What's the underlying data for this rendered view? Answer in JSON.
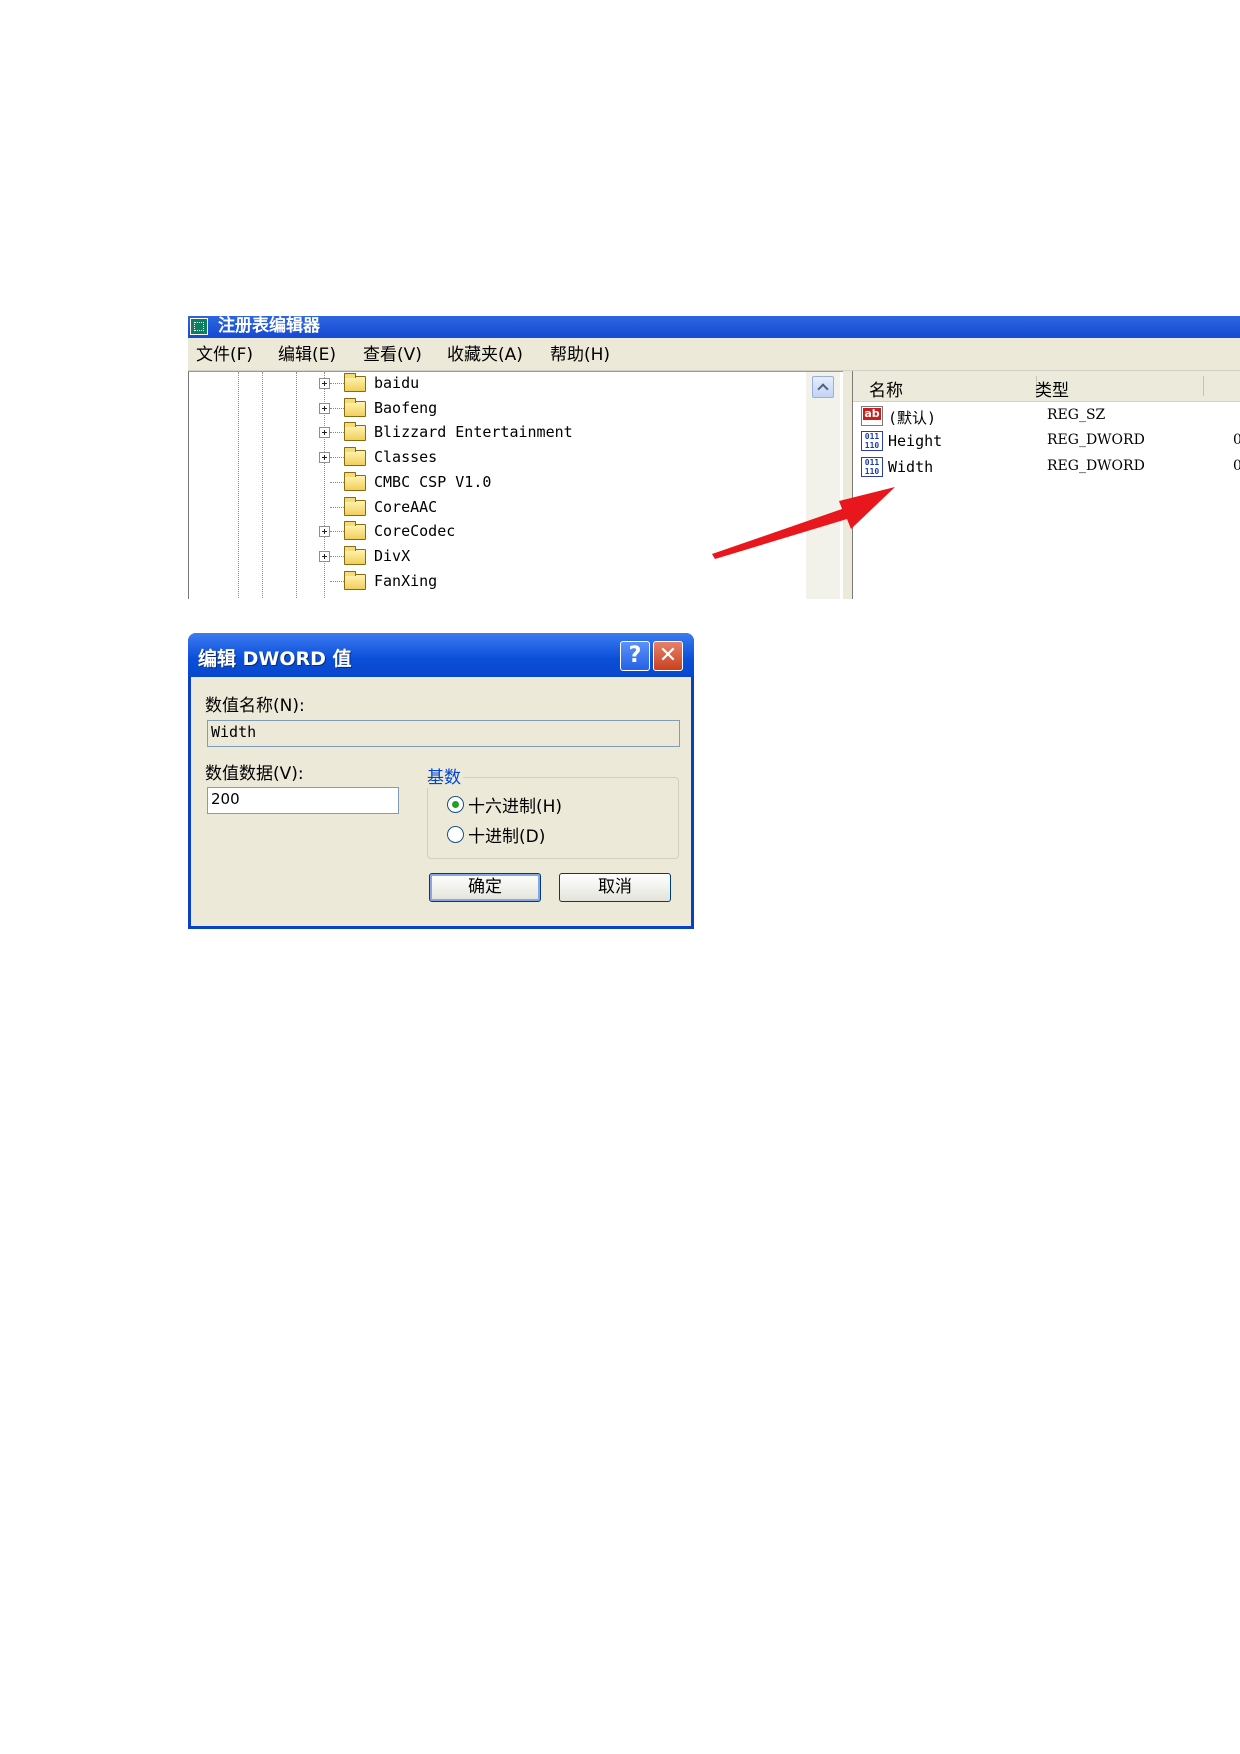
{
  "regedit": {
    "title": "注册表编辑器",
    "menu": [
      "文件(F)",
      "编辑(E)",
      "查看(V)",
      "收藏夹(A)",
      "帮助(H)"
    ],
    "tree_items": [
      {
        "label": "baidu",
        "expandable": true
      },
      {
        "label": "Baofeng",
        "expandable": true
      },
      {
        "label": "Blizzard Entertainment",
        "expandable": true
      },
      {
        "label": "Classes",
        "expandable": true
      },
      {
        "label": "CMBC CSP V1.0",
        "expandable": false
      },
      {
        "label": "CoreAAC",
        "expandable": false
      },
      {
        "label": "CoreCodec",
        "expandable": true
      },
      {
        "label": "DivX",
        "expandable": true
      },
      {
        "label": "FanXing",
        "expandable": false
      }
    ],
    "columns": {
      "name": "名称",
      "type": "类型"
    },
    "values": [
      {
        "name": "(默认)",
        "type": "REG_SZ",
        "data": "",
        "icon": "string-value-icon"
      },
      {
        "name": "Height",
        "type": "REG_DWORD",
        "data": "0",
        "icon": "binary-value-icon"
      },
      {
        "name": "Width",
        "type": "REG_DWORD",
        "data": "0",
        "icon": "binary-value-icon"
      }
    ]
  },
  "dialog": {
    "title": "编辑 DWORD 值",
    "help_label": "?",
    "close_label": "✕",
    "value_name_label": "数值名称(N):",
    "value_name": "Width",
    "value_data_label": "数值数据(V):",
    "value_data": "200",
    "base_label": "基数",
    "hex_label": "十六进制(H)",
    "dec_label": "十进制(D)",
    "selected_base": "hex",
    "ok_label": "确定",
    "cancel_label": "取消"
  },
  "colors": {
    "xp_blue": "#0a4ed8",
    "dialog_bg": "#ece9d8",
    "arrow_red": "#e8161d",
    "group_title_blue": "#0046d5"
  }
}
